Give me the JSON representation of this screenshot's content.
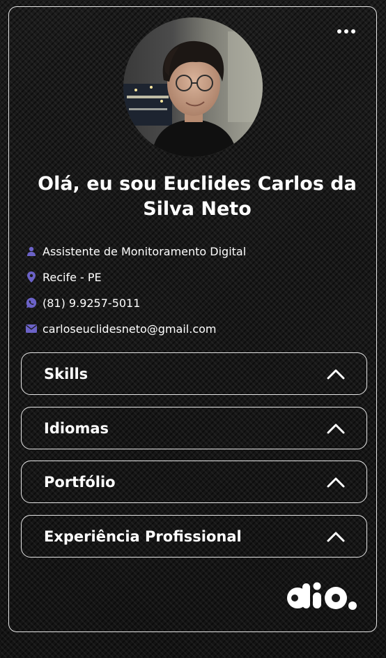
{
  "profile": {
    "greeting": "Olá, eu sou Euclides Carlos da Silva Neto",
    "photo_alt": "Foto de perfil"
  },
  "menu": {
    "icon": "more-horizontal-icon"
  },
  "info": [
    {
      "icon": "user-icon",
      "text": "Assistente de Monitoramento Digital"
    },
    {
      "icon": "location-pin-icon",
      "text": "Recife - PE"
    },
    {
      "icon": "whatsapp-icon",
      "text": "(81) 9.9257-5011"
    },
    {
      "icon": "mail-icon",
      "text": "carloseuclidesneto@gmail.com"
    }
  ],
  "sections": [
    {
      "title": "Skills",
      "icon": "chevron-up-icon"
    },
    {
      "title": "Idiomas",
      "icon": "chevron-up-icon"
    },
    {
      "title": "Portfólio",
      "icon": "chevron-up-icon"
    },
    {
      "title": "Experiência Profissional",
      "icon": "chevron-up-icon"
    }
  ],
  "brand": {
    "logo_icon": "dio-logo"
  },
  "colors": {
    "icon_accent": "#6b62c7",
    "border": "#e6e6e6",
    "text": "#ffffff"
  }
}
